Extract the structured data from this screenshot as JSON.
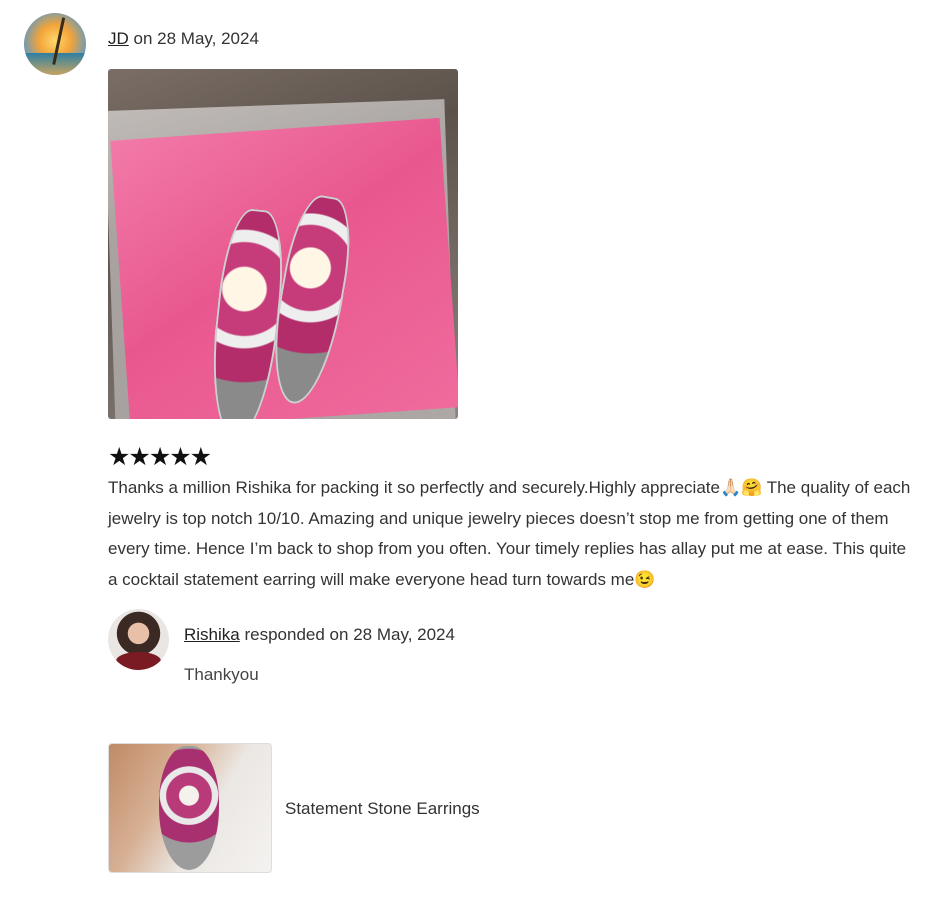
{
  "review": {
    "reviewer_name": "JD",
    "date_prefix": "on",
    "date": "28 May, 2024",
    "rating": 5,
    "stars_text": "★★★★★",
    "text": "Thanks a million Rishika for packing it so perfectly and securely.Highly appreciate🙏🏻🤗 The quality of each jewelry is top notch 10/10. Amazing and unique jewelry pieces doesn’t stop me from getting one of them every time. Hence I’m back to shop from you often. Your timely replies has allay put me at ease. This quite a cocktail statement earring will make everyone head turn towards me😉"
  },
  "reply": {
    "responder_name": "Rishika",
    "responded_prefix": "responded on",
    "date": "28 May, 2024",
    "text": "Thankyou"
  },
  "product": {
    "name": "Statement Stone Earrings"
  }
}
